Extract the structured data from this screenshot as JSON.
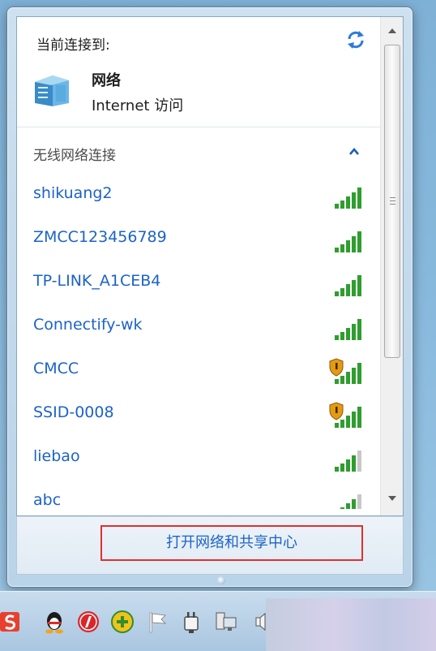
{
  "current": {
    "label": "当前连接到:",
    "network_name": "网络",
    "network_status": "Internet 访问"
  },
  "wireless": {
    "section_title": "无线网络连接",
    "networks": [
      {
        "ssid": "shikuang2",
        "secured": false,
        "signal": 5
      },
      {
        "ssid": "ZMCC123456789",
        "secured": false,
        "signal": 5
      },
      {
        "ssid": "TP-LINK_A1CEB4",
        "secured": false,
        "signal": 5
      },
      {
        "ssid": "Connectify-wk",
        "secured": false,
        "signal": 5
      },
      {
        "ssid": "CMCC",
        "secured": true,
        "signal": 5
      },
      {
        "ssid": "SSID-0008",
        "secured": true,
        "signal": 5
      },
      {
        "ssid": "liebao",
        "secured": false,
        "signal": 4
      },
      {
        "ssid": "abc",
        "secured": false,
        "signal": 4
      }
    ]
  },
  "footer": {
    "open_center_label": "打开网络和共享中心"
  },
  "taskbar": {
    "icons": [
      "sogou-s-icon",
      "qq-penguin-icon",
      "app-red-icon",
      "plus-yellow-icon",
      "flag-icon",
      "power-plug-icon",
      "network-monitor-icon",
      "volume-icon"
    ]
  },
  "colors": {
    "link_blue": "#1c63c7",
    "signal_green": "#2e9e2e",
    "highlight_red": "#e0302f"
  }
}
